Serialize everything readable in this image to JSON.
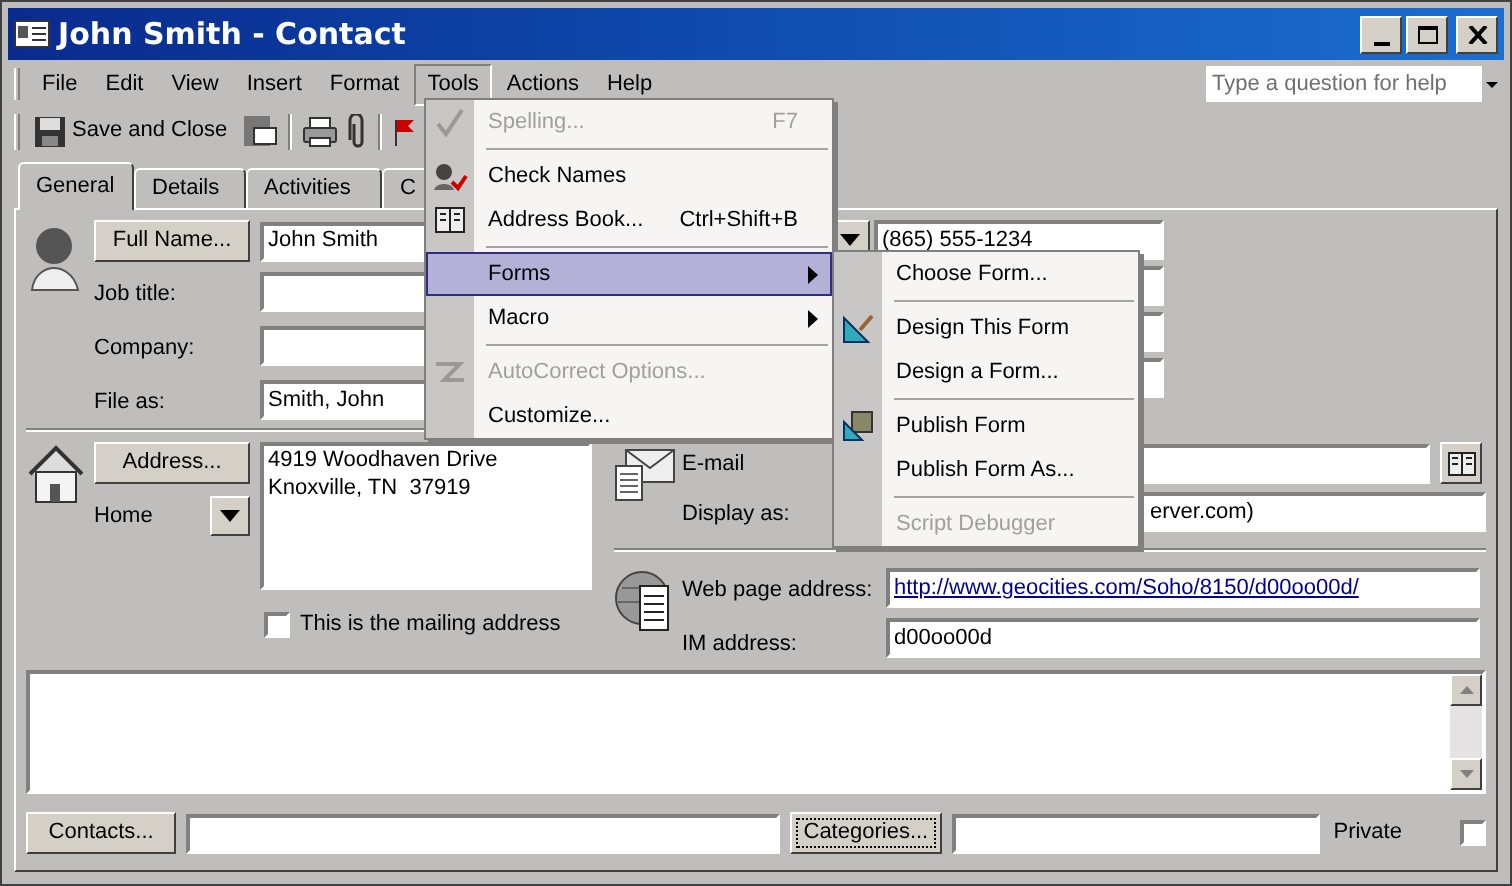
{
  "window": {
    "title": "John Smith - Contact"
  },
  "menu_bar": [
    {
      "label": "File",
      "selected": false
    },
    {
      "label": "Edit",
      "selected": false
    },
    {
      "label": "View",
      "selected": false
    },
    {
      "label": "Insert",
      "selected": false
    },
    {
      "label": "Format",
      "selected": false
    },
    {
      "label": "Tools",
      "selected": true
    },
    {
      "label": "Actions",
      "selected": false
    },
    {
      "label": "Help",
      "selected": false
    }
  ],
  "help_box": {
    "placeholder": "Type a question for help"
  },
  "toolbar": {
    "save_button": "Save and Close"
  },
  "tabs": [
    {
      "label": "General",
      "selected": true
    },
    {
      "label": "Details",
      "selected": false
    },
    {
      "label": "Activities",
      "selected": false
    },
    {
      "label": "C",
      "selected": false
    }
  ],
  "name_section": {
    "full_name_button": "Full Name...",
    "full_name": "John Smith",
    "job_title_label": "Job title:",
    "company_label": "Company:",
    "file_as_label": "File as:",
    "file_as": "Smith, John",
    "phone": "(865) 555-1234"
  },
  "address_section": {
    "address_button": "Address...",
    "address_type": "Home",
    "address_lines": [
      "4919 Woodhaven Drive",
      "Knoxville, TN  37919"
    ],
    "mailing_checkbox": {
      "label": "This is the mailing address",
      "checked": false
    }
  },
  "email_section": {
    "email_label": "E-mail",
    "display_as_label": "Display as:",
    "display_as": "erver.com)"
  },
  "web_section": {
    "web_label": "Web page address:",
    "web_url": "http://www.geocities.com/Soho/8150/d00oo00d/",
    "im_label": "IM address:",
    "im": "d00oo00d"
  },
  "footer": {
    "contacts_button": "Contacts...",
    "categories_button": "Categories...",
    "private_checkbox": {
      "label": "Private",
      "checked": false
    }
  },
  "tools_menu": {
    "items": [
      {
        "kind": "item",
        "label": "Spelling...",
        "shortcut": "F7",
        "disabled": true,
        "selected": false,
        "submenu": false
      },
      {
        "kind": "separator"
      },
      {
        "kind": "item",
        "label": "Check Names",
        "disabled": false,
        "selected": false,
        "submenu": false
      },
      {
        "kind": "item",
        "label": "Address Book...",
        "shortcut": "Ctrl+Shift+B",
        "disabled": false,
        "selected": false,
        "submenu": false
      },
      {
        "kind": "separator"
      },
      {
        "kind": "item",
        "label": "Forms",
        "disabled": false,
        "selected": true,
        "submenu": true
      },
      {
        "kind": "item",
        "label": "Macro",
        "disabled": false,
        "selected": false,
        "submenu": true
      },
      {
        "kind": "separator"
      },
      {
        "kind": "item",
        "label": "AutoCorrect Options...",
        "disabled": true,
        "selected": false,
        "submenu": false
      },
      {
        "kind": "item",
        "label": "Customize...",
        "disabled": false,
        "selected": false,
        "submenu": false
      }
    ]
  },
  "forms_submenu": {
    "items": [
      {
        "kind": "item",
        "label": "Choose Form...",
        "disabled": false,
        "selected": false
      },
      {
        "kind": "separator"
      },
      {
        "kind": "item",
        "label": "Design This Form",
        "disabled": false,
        "selected": false
      },
      {
        "kind": "item",
        "label": "Design a Form...",
        "disabled": false,
        "selected": false
      },
      {
        "kind": "separator"
      },
      {
        "kind": "item",
        "label": "Publish Form",
        "disabled": false,
        "selected": false
      },
      {
        "kind": "item",
        "label": "Publish Form As...",
        "disabled": false,
        "selected": false
      },
      {
        "kind": "separator"
      },
      {
        "kind": "item",
        "label": "Script Debugger",
        "disabled": true,
        "selected": false
      }
    ]
  }
}
